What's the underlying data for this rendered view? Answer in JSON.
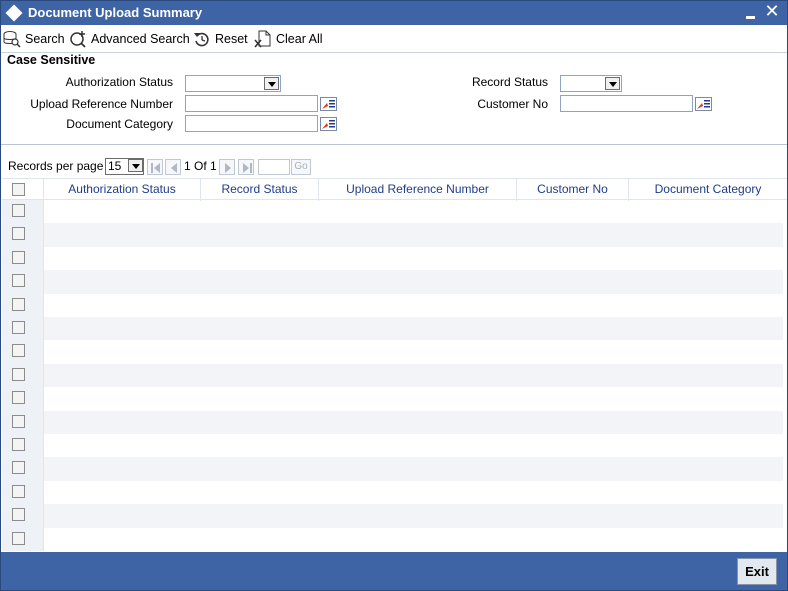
{
  "window": {
    "title": "Document Upload Summary"
  },
  "toolbar": {
    "search_label": "Search",
    "advanced_search_label": "Advanced Search",
    "reset_label": "Reset",
    "clear_all_label": "Clear All"
  },
  "criteria": {
    "section_label": "Case Sensitive",
    "authorization_status_label": "Authorization Status",
    "upload_reference_number_label": "Upload Reference Number",
    "document_category_label": "Document Category",
    "record_status_label": "Record Status",
    "customer_no_label": "Customer No",
    "authorization_status_value": "",
    "record_status_value": "",
    "upload_reference_number_value": "",
    "document_category_value": "",
    "customer_no_value": ""
  },
  "pager": {
    "records_per_page_label": "Records per page",
    "records_per_page_value": "15",
    "page_text": "1 Of 1",
    "go_label": "Go"
  },
  "grid": {
    "columns": [
      "Authorization Status",
      "Record Status",
      "Upload Reference Number",
      "Customer No",
      "Document Category"
    ],
    "row_count": 15
  },
  "footer": {
    "exit_label": "Exit"
  },
  "colors": {
    "titlebar": "#3f64a6",
    "header_text": "#1f3d8a",
    "lov_red": "#d93a1a"
  }
}
